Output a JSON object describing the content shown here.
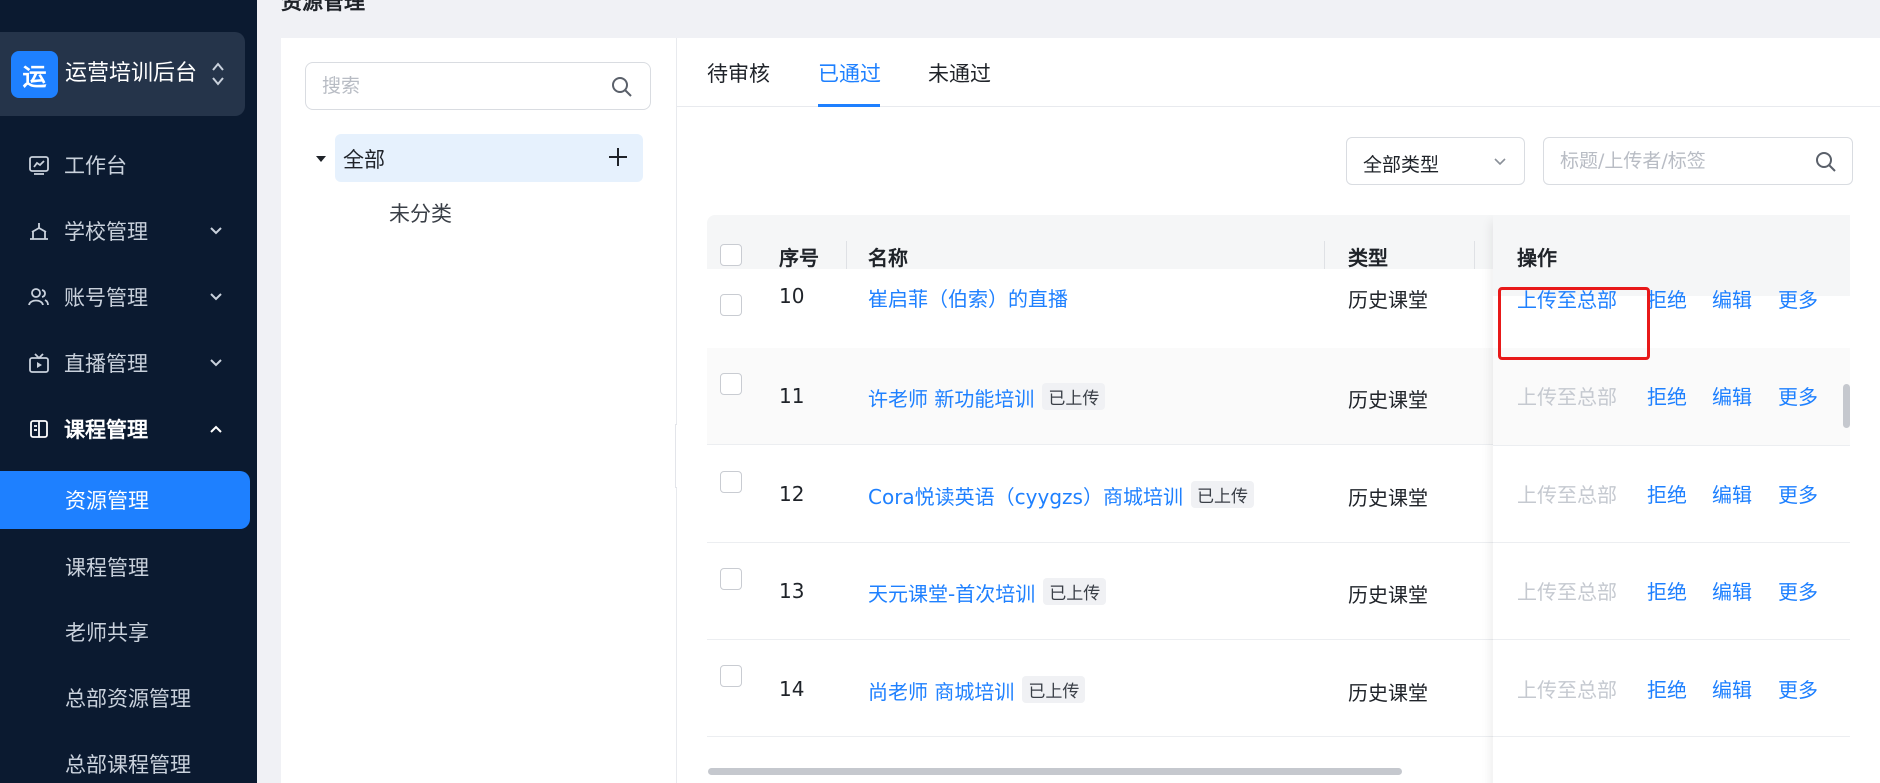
{
  "app": {
    "logo_char": "运",
    "name": "运营培训后台"
  },
  "sidebar": {
    "items": [
      {
        "label": "工作台",
        "icon": "dashboard-icon"
      },
      {
        "label": "学校管理",
        "icon": "school-icon"
      },
      {
        "label": "账号管理",
        "icon": "users-icon"
      },
      {
        "label": "直播管理",
        "icon": "live-tv-icon"
      },
      {
        "label": "课程管理",
        "icon": "book-icon"
      }
    ],
    "sub_items": [
      {
        "label": "资源管理"
      },
      {
        "label": "课程管理"
      },
      {
        "label": "老师共享"
      },
      {
        "label": "总部资源管理"
      },
      {
        "label": "总部课程管理"
      }
    ]
  },
  "page": {
    "title": "资源管理"
  },
  "tree": {
    "search_placeholder": "搜索",
    "root_label": "全部",
    "child_label": "未分类"
  },
  "tabs": [
    {
      "label": "待审核"
    },
    {
      "label": "已通过"
    },
    {
      "label": "未通过"
    }
  ],
  "filters": {
    "type_value": "全部类型",
    "keyword_placeholder": "标题/上传者/标签"
  },
  "table": {
    "headers": {
      "no": "序号",
      "name": "名称",
      "type": "类型",
      "ops": "操作"
    },
    "rows": [
      {
        "no": "10",
        "name": "崔启菲（伯索）的直播",
        "tag": "",
        "type": "历史课堂",
        "upload_disabled": false
      },
      {
        "no": "11",
        "name": "许老师 新功能培训",
        "tag": "已上传",
        "type": "历史课堂",
        "upload_disabled": true
      },
      {
        "no": "12",
        "name": "Cora悦读英语（cyygzs）商城培训",
        "tag": "已上传",
        "type": "历史课堂",
        "upload_disabled": true
      },
      {
        "no": "13",
        "name": "天元课堂-首次培训",
        "tag": "已上传",
        "type": "历史课堂",
        "upload_disabled": true
      },
      {
        "no": "14",
        "name": "尚老师 商城培训",
        "tag": "已上传",
        "type": "历史课堂",
        "upload_disabled": true
      }
    ],
    "actions": {
      "upload": "上传至总部",
      "reject": "拒绝",
      "edit": "编辑",
      "more": "更多"
    }
  },
  "colors": {
    "accent": "#1e80ff",
    "sidebar_bg": "#0b1a30",
    "highlight": "#e81919"
  }
}
